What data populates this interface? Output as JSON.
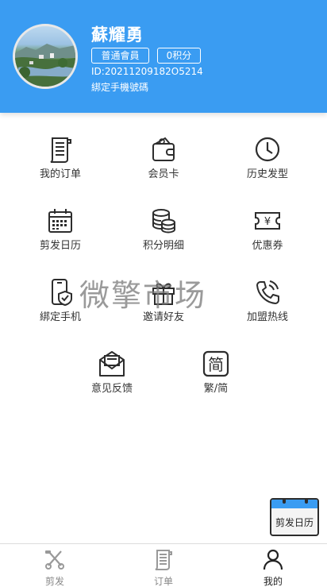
{
  "profile": {
    "name": "蘇耀勇",
    "level": "普通會員",
    "points": "0积分",
    "id": "ID:20211209182O5214",
    "bind_phone": "綁定手機號碼"
  },
  "menu": [
    {
      "label": "我的订单",
      "icon": "order-list-icon"
    },
    {
      "label": "会员卡",
      "icon": "wallet-icon"
    },
    {
      "label": "历史发型",
      "icon": "clock-icon"
    },
    {
      "label": "剪发日历",
      "icon": "calendar-icon"
    },
    {
      "label": "积分明细",
      "icon": "coins-icon"
    },
    {
      "label": "优惠券",
      "icon": "coupon-icon"
    },
    {
      "label": "綁定手机",
      "icon": "phone-shield-icon"
    },
    {
      "label": "邀请好友",
      "icon": "gift-icon"
    },
    {
      "label": "加盟热线",
      "icon": "phone-call-icon"
    },
    {
      "label": "意见反馈",
      "icon": "mail-icon"
    },
    {
      "label": "繁/简",
      "icon": "simplified-char-icon"
    }
  ],
  "watermark": "微擎市场",
  "floating": {
    "label": "剪发日历"
  },
  "tabbar": [
    {
      "label": "剪发",
      "icon": "scissors-icon"
    },
    {
      "label": "订单",
      "icon": "order-list-icon"
    },
    {
      "label": "我的",
      "icon": "user-icon"
    }
  ],
  "colors": {
    "accent": "#3a9cf2",
    "text": "#333333"
  }
}
